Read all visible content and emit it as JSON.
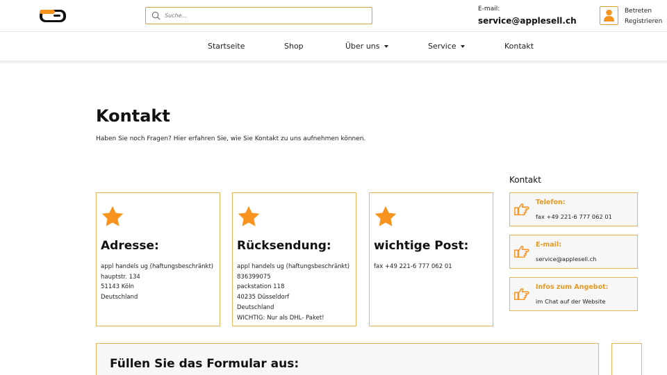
{
  "colors": {
    "accent": "#f7931e",
    "border": "#e6b55a",
    "heading_accent": "#e39a24"
  },
  "header": {
    "search_placeholder": "Suche...",
    "email_label": "E-mail:",
    "email_value": "service@applesell.ch",
    "login_label": "Betreten",
    "register_label": "Registrieren",
    "icons": {
      "logo": "logo-icon",
      "search": "search-icon",
      "user": "user-icon"
    }
  },
  "nav": {
    "items": [
      {
        "label": "Startseite"
      },
      {
        "label": "Shop"
      },
      {
        "label": "Über uns"
      },
      {
        "label": "Service"
      },
      {
        "label": "Kontakt"
      }
    ]
  },
  "main": {
    "title": "Kontakt",
    "intro": "Haben Sie noch Fragen? Hier erfahren Sie, wie Sie Kontakt zu uns aufnehmen können.",
    "cards": [
      {
        "title": "Adresse:",
        "lines": [
          "appl handels ug (haftungsbeschränkt)",
          "hauptstr. 134",
          "51143 Köln",
          "Deutschland"
        ]
      },
      {
        "title": "Rücksendung:",
        "lines": [
          "appl handels ug (haftungsbeschränkt)",
          "836399075",
          "packstation 118",
          "40235 Düsseldorf",
          "Deutschland",
          "WICHTIG: Nur als DHL- Paket!"
        ]
      },
      {
        "title": "wichtige Post:",
        "lines": [
          "fax +49 221-6 777 062 01"
        ]
      }
    ],
    "form_title": "Füllen Sie das Formular aus:"
  },
  "sidebar": {
    "title": "Kontakt",
    "boxes": [
      {
        "title": "Telefon:",
        "value": "fax +49 221-6 777 062 01"
      },
      {
        "title": "E-mail:",
        "value": "service@applesell.ch"
      },
      {
        "title": "Infos zum Angebot:",
        "value": "im Chat auf der Website"
      }
    ]
  }
}
